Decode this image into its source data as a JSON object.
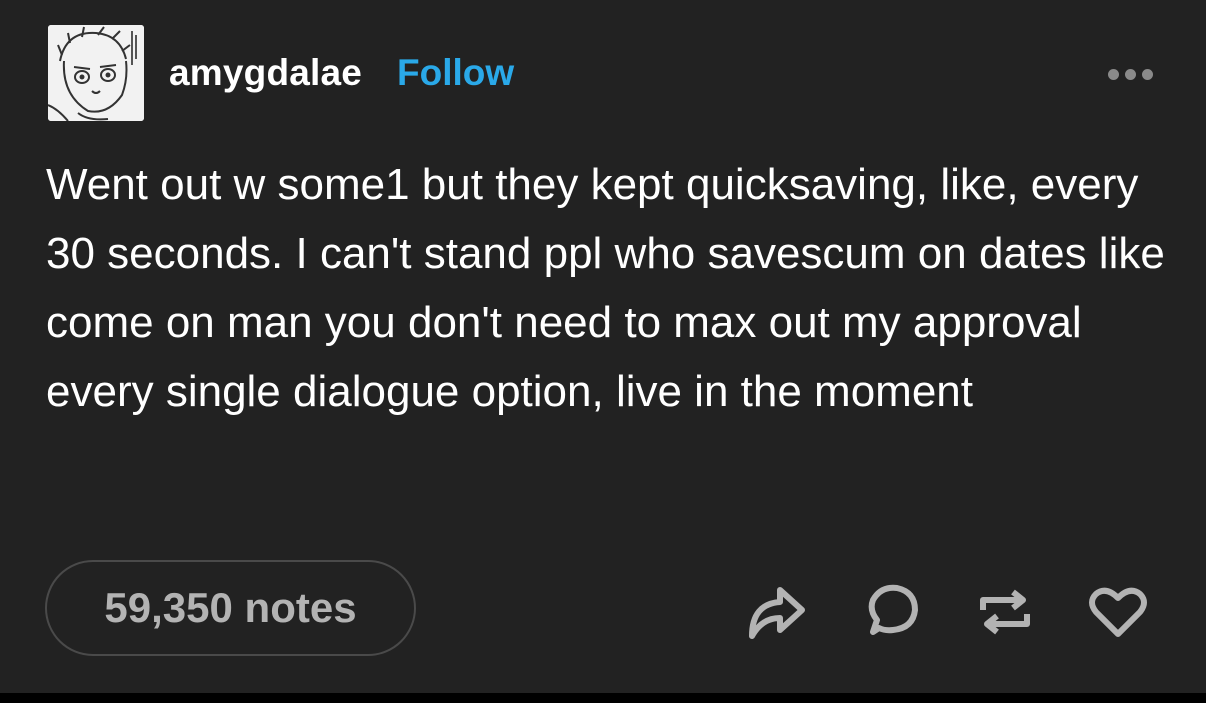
{
  "post": {
    "username": "amygdalae",
    "follow_label": "Follow",
    "body_text": "Went out w some1 but they kept quicksaving, like, every 30 seconds. I can't stand ppl who savescum on dates like come on man you don't need to max out my approval every single dialogue option, live in the moment",
    "notes_count": "59,350 notes"
  },
  "icons": {
    "avatar": "avatar-sketch",
    "more": "more-dots-icon",
    "share": "share-arrow-icon",
    "reply": "comment-bubble-icon",
    "reblog": "reblog-icon",
    "like": "heart-icon"
  },
  "colors": {
    "background": "#222222",
    "text": "#ffffff",
    "follow_accent": "#2aa9e9",
    "muted": "#b3b3b3"
  }
}
